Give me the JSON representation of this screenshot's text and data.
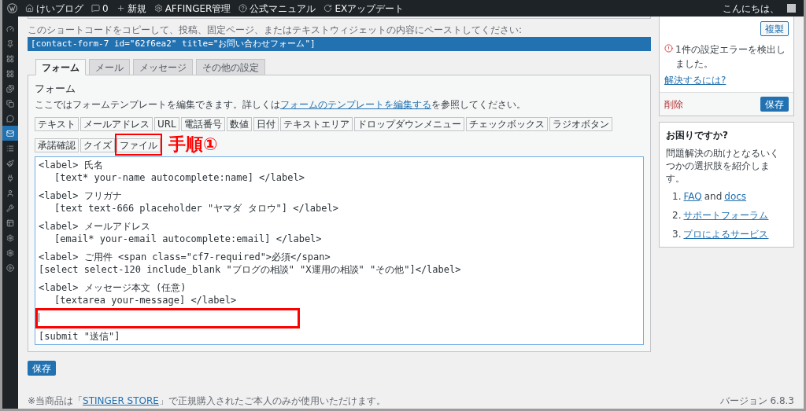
{
  "admin_bar": {
    "items": [
      {
        "kind": "home",
        "label": "けいブログ"
      },
      {
        "kind": "comment",
        "label": "0"
      },
      {
        "kind": "plus",
        "label": "新規"
      },
      {
        "kind": "gear",
        "label": "AFFINGER管理"
      },
      {
        "kind": "help",
        "label": "公式マニュアル"
      },
      {
        "kind": "refresh",
        "label": "EXアップデート"
      }
    ],
    "greeting": "こんにちは、"
  },
  "sidebar": {
    "items": [
      {
        "kind": "gauge",
        "selected": false
      },
      {
        "kind": "pin",
        "selected": false
      },
      {
        "kind": "grid",
        "selected": false
      },
      {
        "kind": "grid",
        "selected": false
      },
      {
        "kind": "media",
        "selected": false
      },
      {
        "kind": "pages",
        "selected": false
      },
      {
        "kind": "comments",
        "selected": false
      },
      {
        "kind": "mail",
        "selected": true
      },
      {
        "kind": "list",
        "selected": false
      },
      {
        "kind": "brush",
        "selected": false
      },
      {
        "kind": "plug",
        "selected": false
      },
      {
        "kind": "user",
        "selected": false
      },
      {
        "kind": "wrench",
        "selected": false
      },
      {
        "kind": "panel",
        "selected": false
      },
      {
        "kind": "gear",
        "selected": false
      },
      {
        "kind": "gear",
        "selected": false
      },
      {
        "kind": "play",
        "selected": false
      }
    ]
  },
  "shortcode": {
    "instruction": "このショートコードをコピーして、投稿、固定ページ、またはテキストウィジェットの内容にペーストしてください:",
    "code": "[contact-form-7 id=\"62f6ea2\" title=\"お問い合わせフォーム\"]"
  },
  "tabs": [
    {
      "label": "フォーム",
      "selected": true
    },
    {
      "label": "メール",
      "selected": false
    },
    {
      "label": "メッセージ",
      "selected": false
    },
    {
      "label": "その他の設定",
      "selected": false
    }
  ],
  "form": {
    "heading": "フォーム",
    "description_before": "ここではフォームテンプレートを編集できます。詳しくは",
    "description_link": "フォームのテンプレートを編集する",
    "description_after": "を参照してください。",
    "tag_buttons": [
      {
        "label": "テキスト",
        "highlighted": false
      },
      {
        "label": "メールアドレス",
        "highlighted": false
      },
      {
        "label": "URL",
        "highlighted": false
      },
      {
        "label": "電話番号",
        "highlighted": false
      },
      {
        "label": "数値",
        "highlighted": false
      },
      {
        "label": "日付",
        "highlighted": false
      },
      {
        "label": "テキストエリア",
        "highlighted": false
      },
      {
        "label": "ドロップダウンメニュー",
        "highlighted": false
      },
      {
        "label": "チェックボックス",
        "highlighted": false
      },
      {
        "label": "ラジオボタン",
        "highlighted": false
      },
      {
        "label": "承諾確認",
        "highlighted": false
      },
      {
        "label": "クイズ",
        "highlighted": false
      },
      {
        "label": "ファイル",
        "highlighted": true
      }
    ],
    "annotation": "手順①",
    "editor": {
      "blocks": [
        {
          "kind": "code",
          "lines": [
            {
              "text": "<label> 氏名",
              "indented": false
            },
            {
              "text": "[text* your-name autocomplete:name] </label>",
              "indented": true
            }
          ]
        },
        {
          "kind": "code",
          "lines": [
            {
              "text": "<label> フリガナ",
              "indented": false
            },
            {
              "text": "[text text-666 placeholder \"ヤマダ タロウ\"] </label>",
              "indented": true
            }
          ]
        },
        {
          "kind": "code",
          "lines": [
            {
              "text": "<label> メールアドレス",
              "indented": false
            },
            {
              "text": "[email* your-email autocomplete:email] </label>",
              "indented": true
            }
          ]
        },
        {
          "kind": "code",
          "lines": [
            {
              "text": "<label> ご用件 <span class=\"cf7-required\">必須</span>",
              "indented": false
            },
            {
              "text": "[select select-120 include_blank \"ブログの相談\" \"X運用の相談\" \"その他\"]</label>",
              "indented": false
            }
          ]
        },
        {
          "kind": "code",
          "lines": [
            {
              "text": "<label> メッセージ本文 (任意)",
              "indented": false
            },
            {
              "text": "[textarea your-message] </label>",
              "indented": true
            }
          ]
        },
        {
          "kind": "cursor",
          "highlighted": true
        },
        {
          "kind": "code",
          "lines": [
            {
              "text": "[submit \"送信\"]",
              "indented": false
            }
          ]
        }
      ]
    }
  },
  "save_button": "保存",
  "status_box": {
    "duplicate_button": "複製",
    "error": "1件の設定エラーを検出しました。",
    "error_link": "解決するには?",
    "delete_link": "削除",
    "save_button": "保存"
  },
  "help_box": {
    "title": "お困りですか?",
    "text": "問題解決の助けとなるいくつかの選択肢を紹介します。",
    "links": [
      {
        "number": "1.",
        "parts": [
          {
            "text": "FAQ",
            "link": true
          },
          {
            "text": "and",
            "link": false
          },
          {
            "text": "docs",
            "link": true
          }
        ]
      },
      {
        "number": "2.",
        "parts": [
          {
            "text": "サポートフォーラム",
            "link": true
          }
        ]
      },
      {
        "number": "3.",
        "parts": [
          {
            "text": "プロによるサービス",
            "link": true
          }
        ]
      }
    ]
  },
  "footer": {
    "before": "※当商品は「",
    "link": "STINGER STORE",
    "after": "」で正規購入されたご本人のみが使用いただけます。",
    "version": "バージョン 6.8.3"
  }
}
